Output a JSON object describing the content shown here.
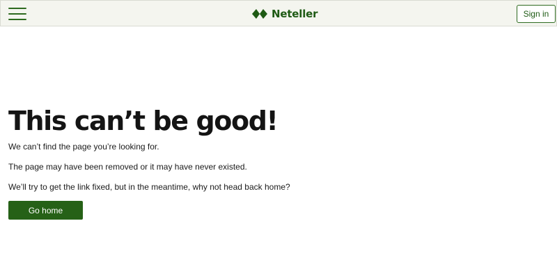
{
  "header": {
    "menu_icon": "hamburger-menu-icon",
    "logo_icon": "neteller-diamond-icon",
    "logo_text": "Neteller",
    "signin_label": "Sign in",
    "colors": {
      "background": "#f4f5ef",
      "brand_green": "#1e5a14"
    }
  },
  "main": {
    "title": "This can’t be good!",
    "messages": [
      "We can’t find the page you’re looking for.",
      "The page may have been removed or it may have never existed.",
      "We’ll try to get the link fixed, but in the meantime, why not head back home?"
    ],
    "go_home_label": "Go home",
    "colors": {
      "button": "#266117",
      "button_text": "#ffffff"
    }
  }
}
